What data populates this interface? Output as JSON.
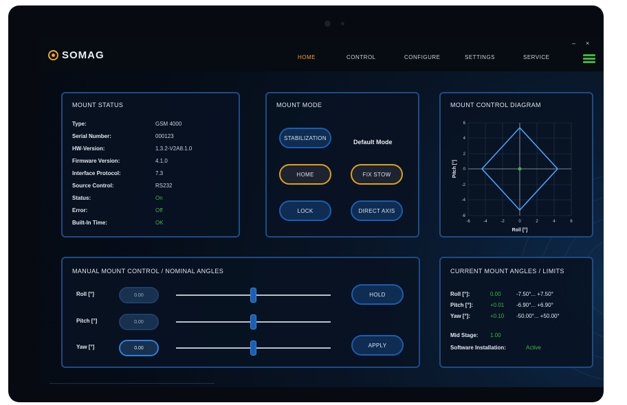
{
  "app": {
    "brand": "SOMAG"
  },
  "window_controls": {
    "minimize": "–",
    "close": "×"
  },
  "nav": [
    "HOME",
    "CONTROL",
    "CONFIGURE",
    "SETTINGS",
    "SERVICE"
  ],
  "mount_status": {
    "title": "MOUNT STATUS",
    "rows": [
      {
        "key": "Type:",
        "value": "GSM 4000"
      },
      {
        "key": "Serial Number:",
        "value": "000123"
      },
      {
        "key": "HW-Version:",
        "value": "1.3.2-V2A8.1.0"
      },
      {
        "key": "Firmware Version:",
        "value": "4.1.0"
      },
      {
        "key": "Interface Protocol:",
        "value": "7.3"
      },
      {
        "key": "Source Control:",
        "value": "RS232"
      },
      {
        "key": "Status:",
        "value": "On"
      },
      {
        "key": "Error:",
        "value": "Off"
      },
      {
        "key": "Built-In Time:",
        "value": "OK"
      }
    ]
  },
  "mount_mode": {
    "title": "MOUNT MODE",
    "default_label": "Default Mode",
    "buttons": [
      "STABILIZATION",
      "HOME",
      "FIX STOW",
      "LOCK",
      "DIRECT AXIS"
    ]
  },
  "diagram": {
    "title": "MOUNT CONTROL DIAGRAM",
    "ylabel": "Pitch [°]",
    "xlabel": "Roll [°]",
    "y_ticks": [
      "6",
      "4",
      "2",
      "0",
      "-2",
      "-4",
      "-6"
    ],
    "x_ticks": [
      "-6",
      "-4",
      "-2",
      "0",
      "2",
      "4",
      "6"
    ],
    "limit_color": "#4aa3ff",
    "marker_color": "#3fb73f"
  },
  "manual": {
    "title": "MANUAL MOUNT CONTROL / NOMINAL ANGLES",
    "rows": [
      {
        "label": "Roll [°]",
        "value": "0.00",
        "level": 0.5
      },
      {
        "label": "Pitch [°]",
        "value": "0.00",
        "level": 0.5
      },
      {
        "label": "Yaw [°]",
        "value": "0.00",
        "level": 0.5
      }
    ],
    "buttons": [
      "HOLD",
      "APPLY"
    ]
  },
  "limits": {
    "title": "CURRENT MOUNT ANGLES / LIMITS",
    "rows": [
      {
        "label": "Roll [°]:",
        "value": "0.00",
        "range": "-7.50°... +7.50°"
      },
      {
        "label": "Pitch [°]:",
        "value": "+0.01",
        "range": "-6.90°... +6.90°"
      },
      {
        "label": "Yaw [°]:",
        "value": "+0.10",
        "range": "-50.00°... +50.00°"
      }
    ],
    "heading_label": "Mid Stage:",
    "heading_value": "1.00",
    "conf_label": "Software Installation:",
    "conf_value": "Active"
  }
}
